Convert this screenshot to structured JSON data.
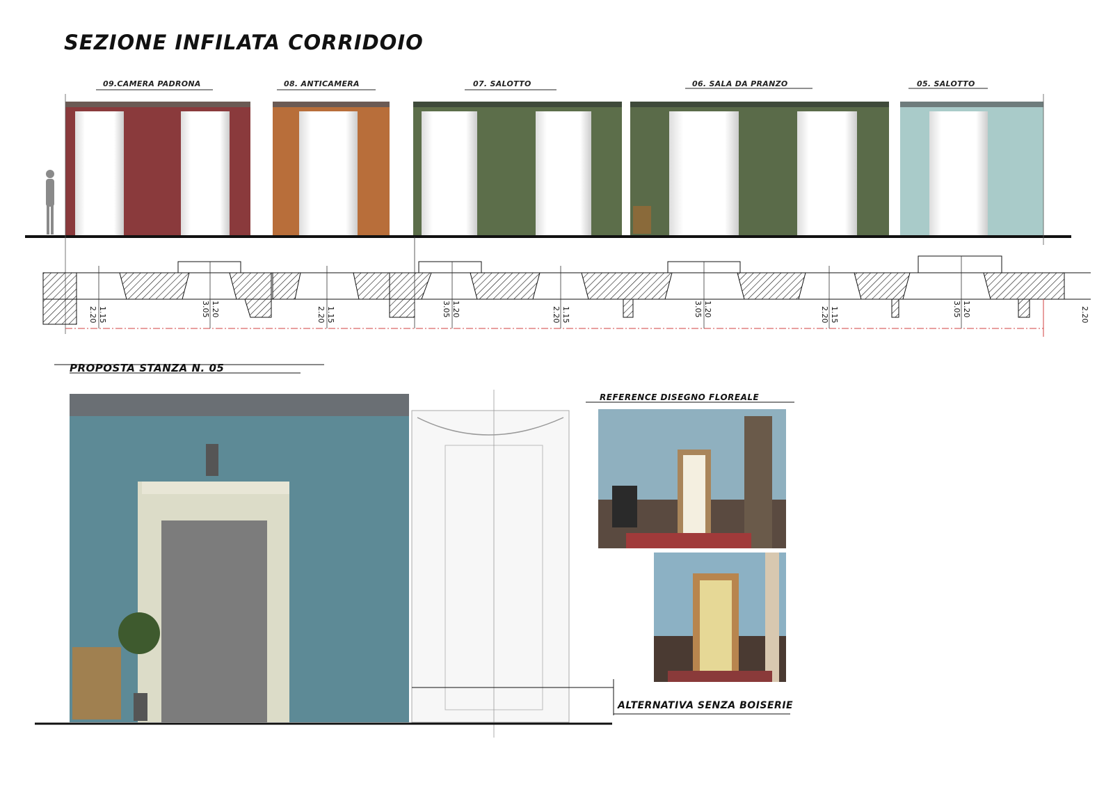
{
  "title": "SEZIONE INFILATA CORRIDOIO",
  "rooms": [
    {
      "label": "09.CAMERA PADRONA",
      "color": "#8a3a3c"
    },
    {
      "label": "08. ANTICAMERA",
      "color": "#b86e3a"
    },
    {
      "label": "07. SALOTTO",
      "color": "#5c6e4a"
    },
    {
      "label": "06. SALA DA PRANZO",
      "color": "#5a6b49"
    },
    {
      "label": "05. SALOTTO",
      "color": "#a9cbc9"
    }
  ],
  "dimensions": [
    {
      "a": "2.20",
      "b": "1.15"
    },
    {
      "a": "3.05",
      "b": "1.20"
    },
    {
      "a": "2.20",
      "b": "1.15"
    },
    {
      "a": "3.05",
      "b": "1.20"
    },
    {
      "a": "2.20",
      "b": "1.15"
    },
    {
      "a": "3.05",
      "b": "1.20"
    },
    {
      "a": "2.20",
      "b": "1.15"
    },
    {
      "a": "3.05",
      "b": "1.20"
    },
    {
      "a": "2.20",
      "b": ""
    }
  ],
  "proposal_label": "PROPOSTA STANZA N. 05",
  "reference_label": "REFERENCE DISEGNO FLOREALE",
  "alternative_label": "ALTERNATIVA SENZA BOISERIE",
  "colors": {
    "wall_blue": "#5d8a96",
    "ink": "#111111",
    "axis_red": "#d04040"
  }
}
